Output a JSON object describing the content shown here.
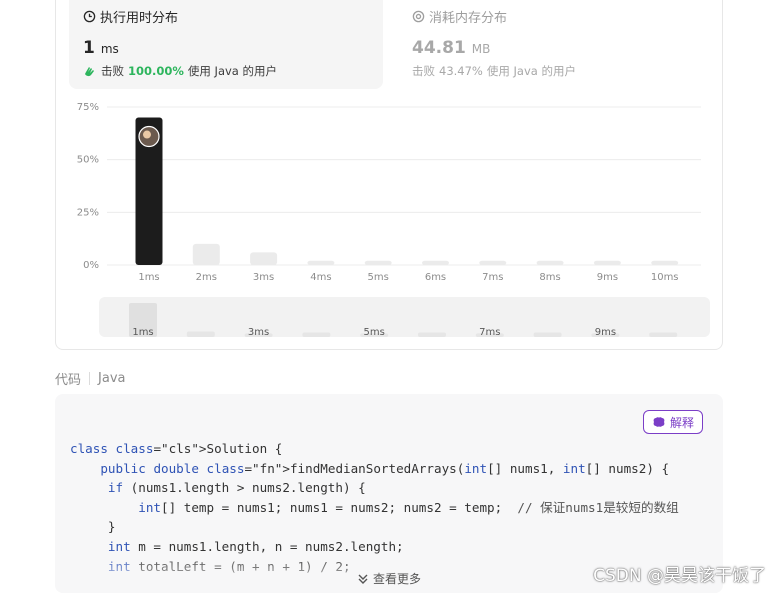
{
  "runtime_card": {
    "title": "执行用时分布",
    "value": "1",
    "unit": "ms",
    "beat_prefix": "击败",
    "beat_pct": "100.00%",
    "beat_suffix": "使用 Java 的用户"
  },
  "memory_card": {
    "title": "消耗内存分布",
    "value": "44.81",
    "unit": "MB",
    "beat_prefix": "击败",
    "beat_pct": "43.47%",
    "beat_suffix": "使用 Java 的用户"
  },
  "chart_data": {
    "type": "bar",
    "categories": [
      "1ms",
      "2ms",
      "3ms",
      "4ms",
      "5ms",
      "6ms",
      "7ms",
      "8ms",
      "9ms",
      "10ms"
    ],
    "values": [
      70,
      10,
      6,
      2,
      2,
      2,
      2,
      2,
      2,
      2
    ],
    "y_ticks": [
      "0%",
      "25%",
      "50%",
      "75%"
    ],
    "ylim": [
      0,
      75
    ],
    "grid": true,
    "highlight_index": 0,
    "colors": {
      "highlight": "#1c1c1c",
      "bar": "#ebebeb",
      "grid": "#ececec"
    },
    "minimap": {
      "values": [
        75,
        12,
        8,
        10,
        8,
        10,
        8,
        10,
        8,
        10
      ],
      "labels": [
        "1ms",
        "",
        "3ms",
        "",
        "5ms",
        "",
        "7ms",
        "",
        "9ms",
        ""
      ]
    }
  },
  "code_section": {
    "label": "代码",
    "language": "Java",
    "explain_label": "解释",
    "more_label": "查看更多",
    "lines": [
      "class Solution {",
      "    public double findMedianSortedArrays(int[] nums1, int[] nums2) {",
      "     if (nums1.length > nums2.length) {",
      "         int[] temp = nums1; nums1 = nums2; nums2 = temp;  // 保证nums1是较短的数组",
      "     }",
      "     int m = nums1.length, n = nums2.length;",
      "     int totalLeft = (m + n + 1) / 2;"
    ]
  },
  "watermark": "CSDN @昊昊该干饭了"
}
